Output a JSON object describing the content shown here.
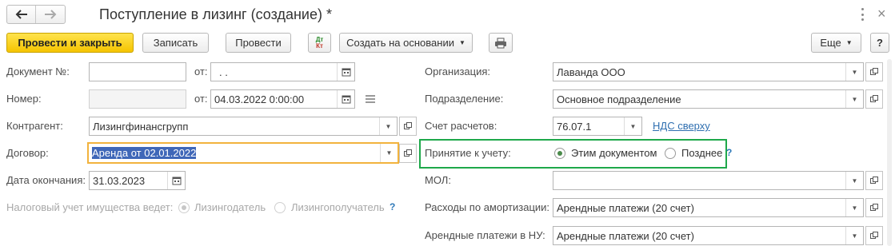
{
  "window": {
    "title": "Поступление в лизинг (создание) *"
  },
  "toolbar": {
    "post_and_close": "Провести и закрыть",
    "save": "Записать",
    "post": "Провести",
    "dt_kt_top": "Дт",
    "dt_kt_bottom": "Кт",
    "create_based_on": "Создать на основании",
    "more": "Еще"
  },
  "colors": {
    "accent_yellow": "#f5c400",
    "highlight_green": "#1ea84a",
    "focus_orange": "#f2b33d",
    "selection_blue": "#3f67b8"
  },
  "form": {
    "doc_no_label": "Документ №:",
    "doc_no_value": "",
    "from_label": "от:",
    "doc_date_value": " .  .",
    "number_label": "Номер:",
    "number_value": "",
    "from2_label": "от:",
    "date_value": "04.03.2022  0:00:00",
    "counterparty_label": "Контрагент:",
    "counterparty_value": "Лизингфинансгрупп",
    "contract_label": "Договор:",
    "contract_value": "Аренда от 02.01.2022",
    "end_date_label": "Дата окончания:",
    "end_date_value": "31.03.2023",
    "tax_label": "Налоговый учет имущества ведет:",
    "tax_option1": "Лизингодатель",
    "tax_option2": "Лизингополучатель",
    "help": "?",
    "org_label": "Организация:",
    "org_value": "Лаванда ООО",
    "dept_label": "Подразделение:",
    "dept_value": "Основное подразделение",
    "account_label": "Счет расчетов:",
    "account_value": "76.07.1",
    "vat_link": "НДС сверху",
    "acceptance_label": "Принятие к учету:",
    "acceptance_option1": "Этим документом",
    "acceptance_option2": "Позднее",
    "mol_label": "МОЛ:",
    "mol_value": "",
    "amort_label": "Расходы по амортизации:",
    "amort_value": "Арендные платежи (20 счет)",
    "nu_label": "Арендные платежи в НУ:",
    "nu_value": "Арендные платежи (20 счет)"
  }
}
